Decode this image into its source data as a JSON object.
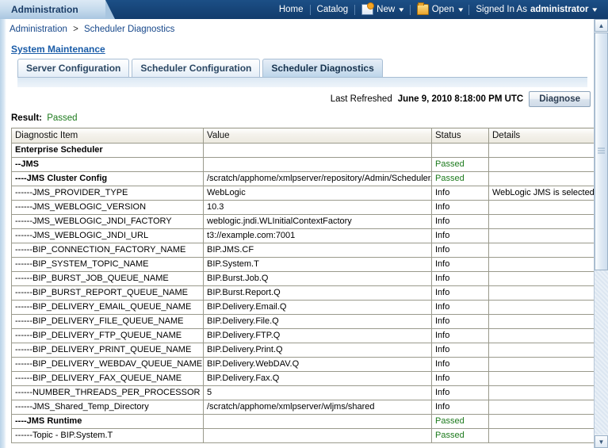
{
  "topbar": {
    "app_tab_label": "Administration",
    "nav": [
      {
        "label": "Home",
        "icon": null,
        "caret": false
      },
      {
        "label": "Catalog",
        "icon": null,
        "caret": false
      },
      {
        "label": "New",
        "icon": "new-page-icon",
        "caret": true
      },
      {
        "label": "Open",
        "icon": "folder-icon",
        "caret": true
      }
    ],
    "signed_in_prefix": "Signed In As",
    "signed_in_user": "administrator"
  },
  "breadcrumb": {
    "root": "Administration",
    "separator": ">",
    "current": "Scheduler Diagnostics"
  },
  "section": {
    "title": "System Maintenance"
  },
  "tabs": [
    {
      "label": "Server Configuration",
      "active": false
    },
    {
      "label": "Scheduler Configuration",
      "active": false
    },
    {
      "label": "Scheduler Diagnostics",
      "active": true
    }
  ],
  "toolbar": {
    "last_refreshed_label": "Last Refreshed",
    "last_refreshed_value": "June 9, 2010 8:18:00 PM UTC",
    "diagnose_label": "Diagnose"
  },
  "result": {
    "label": "Result:",
    "value": "Passed",
    "color": "#1c7a1c"
  },
  "table": {
    "columns": [
      "Diagnostic Item",
      "Value",
      "Status",
      "Details"
    ],
    "rows": [
      {
        "item": "Enterprise Scheduler",
        "bold": true,
        "value": "",
        "status": "",
        "details": ""
      },
      {
        "item": "--JMS",
        "bold": true,
        "value": "",
        "status": "Passed",
        "details": ""
      },
      {
        "item": "----JMS Cluster Config",
        "bold": true,
        "value": "/scratch/apphome/xmlpserver/repository/Admin/Scheduler/jms_cluster_config.properties",
        "status": "Passed",
        "details": ""
      },
      {
        "item": "------JMS_PROVIDER_TYPE",
        "bold": false,
        "value": "WebLogic",
        "status": "Info",
        "details": "WebLogic JMS is selected."
      },
      {
        "item": "------JMS_WEBLOGIC_VERSION",
        "bold": false,
        "value": "10.3",
        "status": "Info",
        "details": ""
      },
      {
        "item": "------JMS_WEBLOGIC_JNDI_FACTORY",
        "bold": false,
        "value": "weblogic.jndi.WLInitialContextFactory",
        "status": "Info",
        "details": ""
      },
      {
        "item": "------JMS_WEBLOGIC_JNDI_URL",
        "bold": false,
        "value": "t3://example.com:7001",
        "status": "Info",
        "details": ""
      },
      {
        "item": "------BIP_CONNECTION_FACTORY_NAME",
        "bold": false,
        "value": "BIP.JMS.CF",
        "status": "Info",
        "details": ""
      },
      {
        "item": "------BIP_SYSTEM_TOPIC_NAME",
        "bold": false,
        "value": "BIP.System.T",
        "status": "Info",
        "details": ""
      },
      {
        "item": "------BIP_BURST_JOB_QUEUE_NAME",
        "bold": false,
        "value": "BIP.Burst.Job.Q",
        "status": "Info",
        "details": ""
      },
      {
        "item": "------BIP_BURST_REPORT_QUEUE_NAME",
        "bold": false,
        "value": "BIP.Burst.Report.Q",
        "status": "Info",
        "details": ""
      },
      {
        "item": "------BIP_DELIVERY_EMAIL_QUEUE_NAME",
        "bold": false,
        "value": "BIP.Delivery.Email.Q",
        "status": "Info",
        "details": ""
      },
      {
        "item": "------BIP_DELIVERY_FILE_QUEUE_NAME",
        "bold": false,
        "value": "BIP.Delivery.File.Q",
        "status": "Info",
        "details": ""
      },
      {
        "item": "------BIP_DELIVERY_FTP_QUEUE_NAME",
        "bold": false,
        "value": "BIP.Delivery.FTP.Q",
        "status": "Info",
        "details": ""
      },
      {
        "item": "------BIP_DELIVERY_PRINT_QUEUE_NAME",
        "bold": false,
        "value": "BIP.Delivery.Print.Q",
        "status": "Info",
        "details": ""
      },
      {
        "item": "------BIP_DELIVERY_WEBDAV_QUEUE_NAME",
        "bold": false,
        "value": "BIP.Delivery.WebDAV.Q",
        "status": "Info",
        "details": ""
      },
      {
        "item": "------BIP_DELIVERY_FAX_QUEUE_NAME",
        "bold": false,
        "value": "BIP.Delivery.Fax.Q",
        "status": "Info",
        "details": ""
      },
      {
        "item": "------NUMBER_THREADS_PER_PROCESSOR",
        "bold": false,
        "value": "5",
        "status": "Info",
        "details": ""
      },
      {
        "item": "------JMS_Shared_Temp_Directory",
        "bold": false,
        "value": "/scratch/apphome/xmlpserver/wljms/shared",
        "status": "Info",
        "details": ""
      },
      {
        "item": "----JMS Runtime",
        "bold": true,
        "value": "",
        "status": "Passed",
        "details": ""
      },
      {
        "item": "------Topic - BIP.System.T",
        "bold": false,
        "value": "",
        "status": "Passed",
        "details": ""
      }
    ]
  },
  "scrollbar": {
    "up_glyph": "▲",
    "down_glyph": "▼"
  }
}
